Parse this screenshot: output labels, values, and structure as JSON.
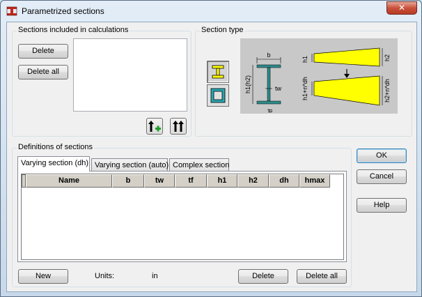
{
  "window": {
    "title": "Parametrized sections",
    "close_symbol": "✕"
  },
  "sections_included": {
    "label": "Sections included in calculations",
    "delete_label": "Delete",
    "delete_all_label": "Delete all",
    "add_icon": "arrow-up-plus-icon",
    "add_all_icon": "double-arrow-up-icon"
  },
  "section_type": {
    "label": "Section type",
    "options": [
      "i-section-icon",
      "box-section-icon"
    ],
    "diagram": {
      "b": "b",
      "tw": "tw",
      "tf": "tf",
      "h1h2": "h1(h2)",
      "h1": "h1",
      "h2": "h2",
      "h1_ndh": "h1+n*dh",
      "h2_ndh": "h2+n*dh"
    }
  },
  "definitions": {
    "label": "Definitions of sections",
    "tabs": [
      "Varying section (dh)",
      "Varying section (auto)",
      "Complex section"
    ],
    "active_tab": 0,
    "columns": [
      "Name",
      "b",
      "tw",
      "tf",
      "h1",
      "h2",
      "dh",
      "hmax"
    ]
  },
  "footer": {
    "new_label": "New",
    "units_label": "Units:",
    "units_value": "in",
    "delete_label": "Delete",
    "delete_all_label": "Delete all"
  },
  "side_buttons": {
    "ok_label": "OK",
    "cancel_label": "Cancel",
    "help_label": "Help"
  },
  "colors": {
    "accent_yellow": "#ffff00",
    "steel_teal": "#2e8a8a"
  }
}
